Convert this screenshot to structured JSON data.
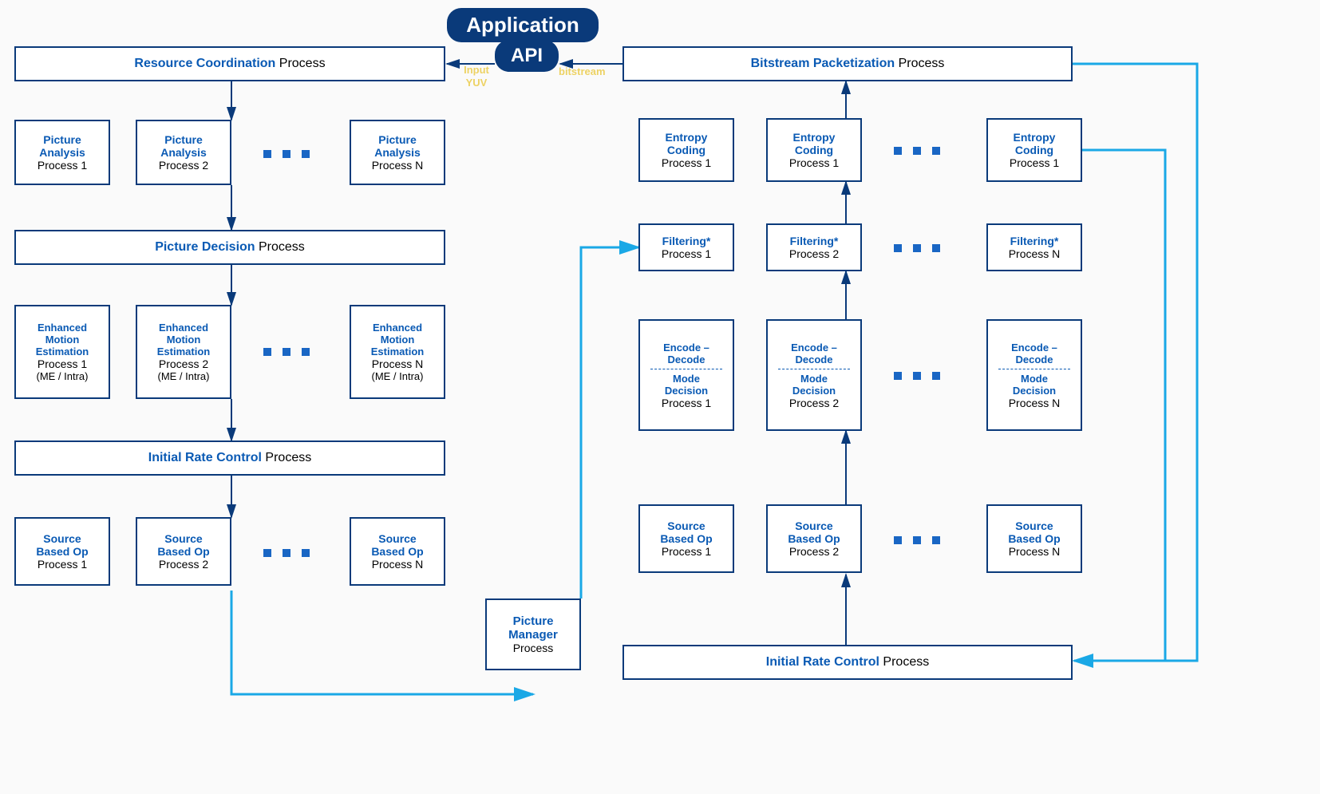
{
  "header": {
    "app": "Application",
    "api": "API"
  },
  "labels": {
    "inputYUV": "Input\nYUV",
    "bitstream": "bitstream"
  },
  "left": {
    "resource": {
      "title": "Resource Coordination",
      "suffix": " Process"
    },
    "pictureAnalysis": {
      "title": "Picture\nAnalysis",
      "p1": "Process 1",
      "p2": "Process 2",
      "pN": "Process N"
    },
    "pictureDecision": {
      "title": "Picture Decision",
      "suffix": " Process"
    },
    "eme": {
      "title": "Enhanced\nMotion\nEstimation",
      "p1": "Process 1",
      "p2": "Process 2",
      "pN": "Process N",
      "tag": "(ME / Intra)"
    },
    "irc": {
      "title": "Initial Rate Control",
      "suffix": " Process"
    },
    "sbo": {
      "title": "Source\nBased Op",
      "p1": "Process 1",
      "p2": "Process 2",
      "pN": "Process N"
    }
  },
  "center": {
    "pm": {
      "title": "Picture\nManager",
      "suffix": "Process"
    }
  },
  "right": {
    "bitstream": {
      "title": "Bitstream Packetization",
      "suffix": " Process"
    },
    "entropy": {
      "title": "Entropy\nCoding",
      "p1": "Process 1",
      "p2": "Process 1",
      "pN": "Process 1"
    },
    "filtering": {
      "title": "Filtering*",
      "p1": "Process 1",
      "p2": "Process 2",
      "pN": "Process N"
    },
    "encdec": {
      "title": "Encode –\nDecode",
      "mode": "Mode\nDecision",
      "p1": "Process 1",
      "p2": "Process 2",
      "pN": "Process N"
    },
    "sbo": {
      "title": "Source\nBased Op",
      "p1": "Process 1",
      "p2": "Process 2",
      "pN": "Process N"
    },
    "irc": {
      "title": "Initial Rate Control",
      "suffix": " Process"
    }
  }
}
